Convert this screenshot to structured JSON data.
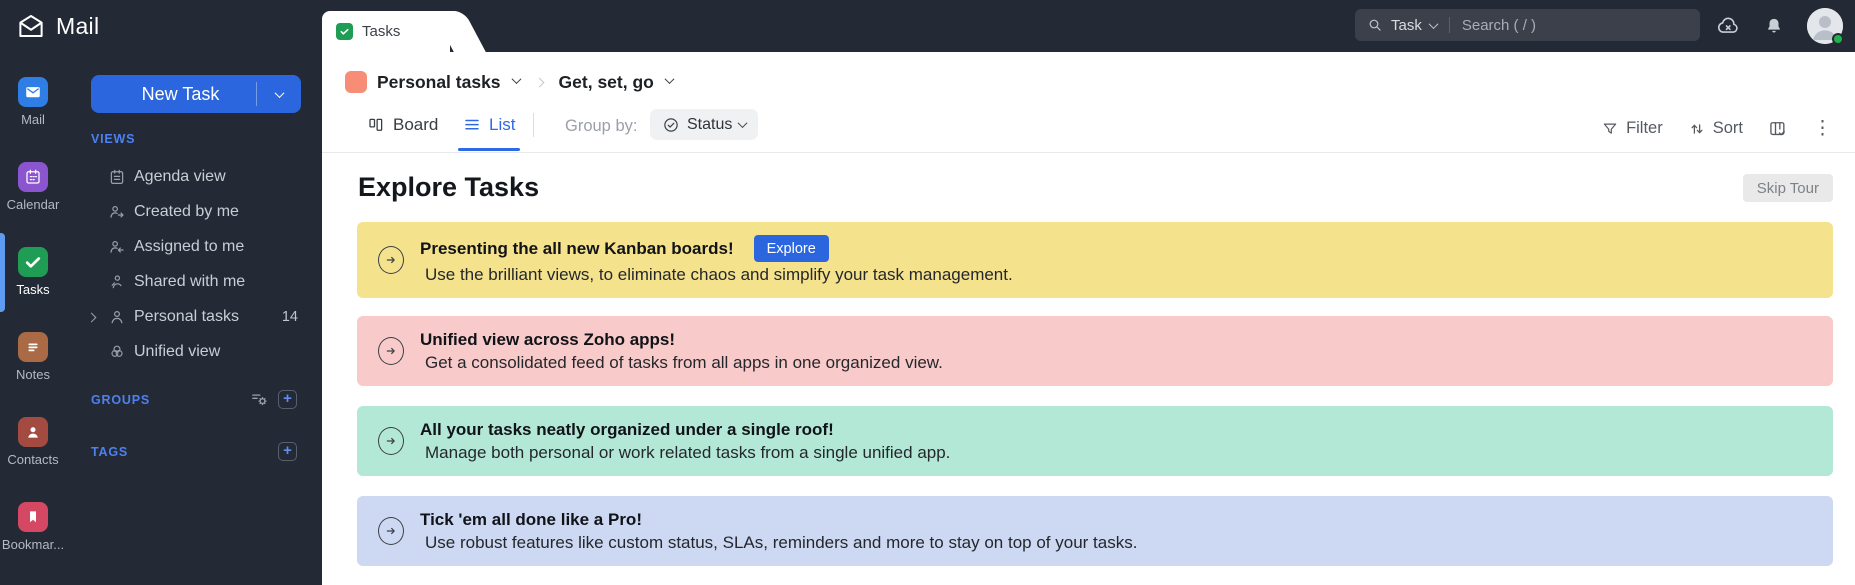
{
  "colors": {
    "chrome_bg": "#242a35",
    "chrome_bg_deep": "#1c212b",
    "accent_blue": "#2b66de",
    "section_blue": "#4d80f0",
    "active_blue": "#2e6be2",
    "rail_mail": "#2e7ee6",
    "rail_calendar": "#8a55cf",
    "rail_tasks": "#1f9d55",
    "rail_notes": "#a96a45",
    "rail_contacts": "#a34a41",
    "rail_bookmarks": "#d44863",
    "tab_check_green": "#1f9d55",
    "breadcrumb_swatch": "#f78d76",
    "presence_green": "#21b14d",
    "banner_yellow": "#f5e28c",
    "banner_pink": "#f9caca",
    "banner_green": "#b4e8d6",
    "banner_blue": "#cdd8f2"
  },
  "topbar": {
    "app_name": "Mail",
    "tab_label": "Tasks",
    "search_scope": "Task",
    "search_placeholder": "Search ( / )"
  },
  "rail": {
    "items": [
      {
        "label": "Mail"
      },
      {
        "label": "Calendar"
      },
      {
        "label": "Tasks"
      },
      {
        "label": "Notes"
      },
      {
        "label": "Contacts"
      },
      {
        "label": "Bookmar..."
      }
    ]
  },
  "sidebar": {
    "new_task_label": "New Task",
    "views_header": "VIEWS",
    "views": [
      {
        "label": "Agenda view"
      },
      {
        "label": "Created by me"
      },
      {
        "label": "Assigned to me"
      },
      {
        "label": "Shared with me"
      },
      {
        "label": "Personal tasks",
        "count": "14"
      },
      {
        "label": "Unified view"
      }
    ],
    "groups_header": "GROUPS",
    "tags_header": "TAGS"
  },
  "main": {
    "breadcrumb": {
      "list_name": "Personal tasks",
      "board_name": "Get, set, go"
    },
    "toolbar": {
      "board_label": "Board",
      "list_label": "List",
      "group_by_label": "Group by:",
      "group_by_value": "Status",
      "filter_label": "Filter",
      "sort_label": "Sort"
    },
    "tour": {
      "heading": "Explore Tasks",
      "skip_label": "Skip Tour",
      "explore_label": "Explore",
      "banners": [
        {
          "title": "Presenting the all new Kanban boards!",
          "subtitle": "Use the brilliant views, to eliminate chaos and simplify your task management."
        },
        {
          "title": "Unified view across Zoho apps!",
          "subtitle": "Get a consolidated feed of tasks from all apps in one organized view."
        },
        {
          "title": "All your tasks neatly organized under a single roof!",
          "subtitle": "Manage both personal or work related tasks from a single unified app."
        },
        {
          "title": "Tick 'em all done like a Pro!",
          "subtitle": "Use robust features like custom status, SLAs, reminders and more to stay on top of your tasks."
        }
      ]
    }
  }
}
